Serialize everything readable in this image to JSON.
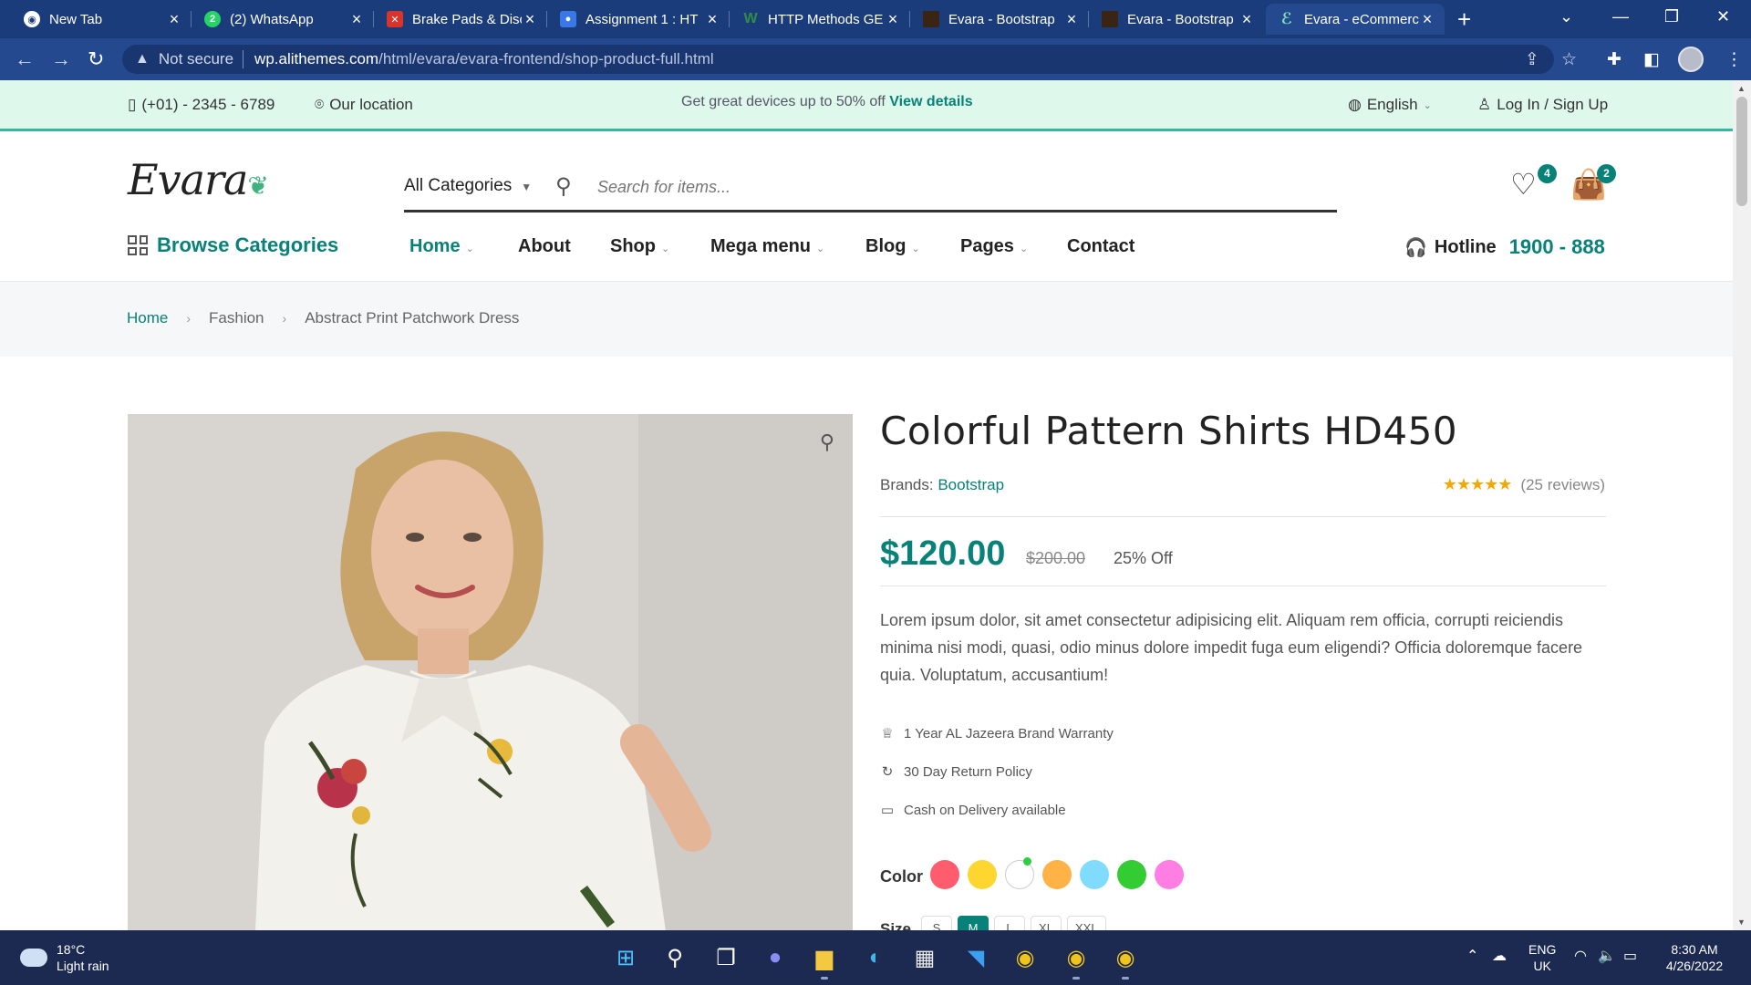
{
  "browser": {
    "tabs": [
      {
        "title": "New Tab",
        "favicon_color": "#1b3c7a",
        "icon": "chrome-icon"
      },
      {
        "title": "(2) WhatsApp",
        "favicon_color": "#25d366",
        "icon": "whatsapp-icon"
      },
      {
        "title": "Brake Pads & Disc",
        "favicon_color": "#d9342b",
        "icon": "tools-icon"
      },
      {
        "title": "Assignment 1 : HT",
        "favicon_color": "#3b78e7",
        "icon": "classroom-icon"
      },
      {
        "title": "HTTP Methods GE",
        "favicon_color": "#2f8d46",
        "icon": "geeks-icon"
      },
      {
        "title": "Evara - Bootstrap",
        "favicon_color": "#3a2414",
        "icon": "themeforest-icon"
      },
      {
        "title": "Evara - Bootstrap",
        "favicon_color": "#3a2414",
        "icon": "themeforest-icon"
      },
      {
        "title": "Evara - eCommerc",
        "favicon_color": "#3fb27f",
        "icon": "evara-icon"
      }
    ],
    "security_label": "Not secure",
    "url_host": "wp.alithemes.com",
    "url_path": "/html/evara/evara-frontend/shop-product-full.html"
  },
  "topbar": {
    "phone": "(+01) - 2345 - 6789",
    "location": "Our location",
    "promo_text": "Get great devices up to 50% off",
    "promo_link": "View details",
    "language": "English",
    "login": "Log In / Sign Up"
  },
  "header": {
    "logo": "Evara",
    "category_select": "All Categories",
    "search_placeholder": "Search for items...",
    "wishlist_count": "4",
    "cart_count": "2"
  },
  "nav": {
    "browse": "Browse Categories",
    "items": [
      "Home",
      "About",
      "Shop",
      "Mega menu",
      "Blog",
      "Pages",
      "Contact"
    ],
    "hotline_label": "Hotline",
    "hotline_number": "1900 - 888"
  },
  "breadcrumb": [
    "Home",
    "Fashion",
    "Abstract Print Patchwork Dress"
  ],
  "product": {
    "title": "Colorful Pattern Shirts HD450",
    "brand_label": "Brands:",
    "brand": "Bootstrap",
    "reviews": "(25 reviews)",
    "rating": 4.5,
    "price": "$120.00",
    "old_price": "$200.00",
    "discount": "25% Off",
    "description": "Lorem ipsum dolor, sit amet consectetur adipisicing elit. Aliquam rem officia, corrupti reiciendis minima nisi modi, quasi, odio minus dolore impedit fuga eum eligendi? Officia doloremque facere quia. Voluptatum, accusantium!",
    "features": [
      {
        "icon": "crown-icon",
        "text": "1 Year AL Jazeera Brand Warranty"
      },
      {
        "icon": "refresh-icon",
        "text": "30 Day Return Policy"
      },
      {
        "icon": "card-icon",
        "text": "Cash on Delivery available"
      }
    ],
    "color_label": "Color",
    "colors": [
      "#ff5d6d",
      "#ffd530",
      "#ffffff",
      "#ffb347",
      "#7fdcff",
      "#33cc33",
      "#ff7ee3"
    ],
    "selected_color_index": 2,
    "size_label": "Size",
    "sizes": [
      "S",
      "M",
      "L",
      "XL",
      "XXL"
    ],
    "selected_size": "M"
  },
  "taskbar": {
    "temperature": "18°C",
    "weather": "Light rain",
    "lang_top": "ENG",
    "lang_bottom": "UK",
    "time": "8:30 AM",
    "date": "4/26/2022"
  }
}
